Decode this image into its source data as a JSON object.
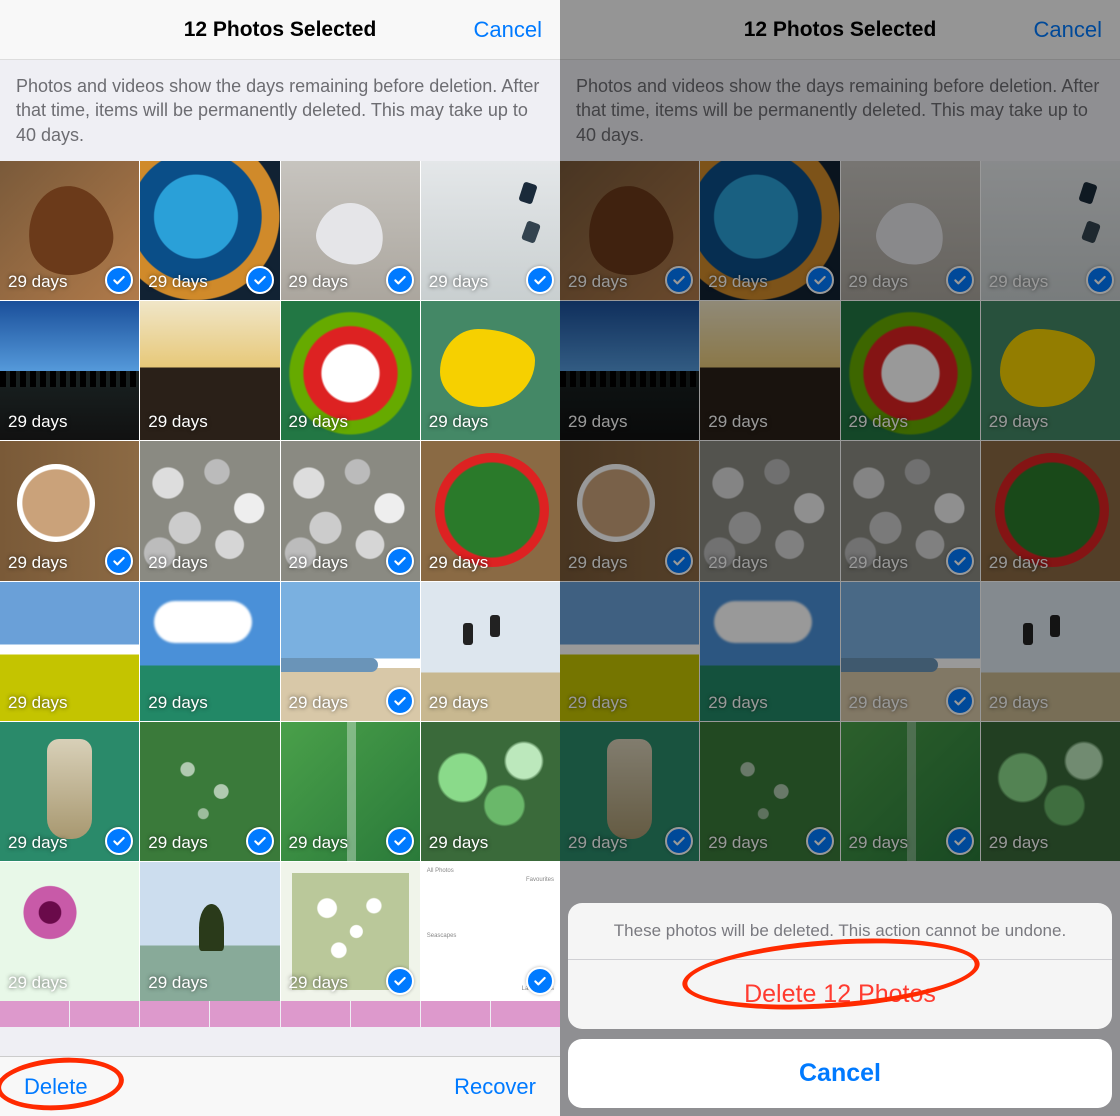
{
  "left": {
    "title": "12 Photos Selected",
    "cancel": "Cancel",
    "info": "Photos and videos show the days remaining before deletion. After that time, items will be permanently deleted. This may take up to 40 days.",
    "delete_label": "Delete",
    "recover_label": "Recover",
    "photos": [
      {
        "days": "29 days",
        "selected": true,
        "art": "t-leaf"
      },
      {
        "days": "29 days",
        "selected": true,
        "art": "t-gear"
      },
      {
        "days": "29 days",
        "selected": true,
        "art": "t-frost"
      },
      {
        "days": "29 days",
        "selected": true,
        "art": "t-jump"
      },
      {
        "days": "29 days",
        "selected": false,
        "art": "t-sky1"
      },
      {
        "days": "29 days",
        "selected": false,
        "art": "t-trees"
      },
      {
        "days": "29 days",
        "selected": false,
        "art": "t-tulip"
      },
      {
        "days": "29 days",
        "selected": false,
        "art": "t-poppy"
      },
      {
        "days": "29 days",
        "selected": true,
        "art": "t-coffee"
      },
      {
        "days": "29 days",
        "selected": false,
        "art": "t-pebbles"
      },
      {
        "days": "29 days",
        "selected": true,
        "art": "t-pebbles"
      },
      {
        "days": "29 days",
        "selected": false,
        "art": "t-salad"
      },
      {
        "days": "29 days",
        "selected": false,
        "art": "t-field"
      },
      {
        "days": "29 days",
        "selected": false,
        "art": "t-clouds"
      },
      {
        "days": "29 days",
        "selected": true,
        "art": "t-beach"
      },
      {
        "days": "29 days",
        "selected": false,
        "art": "t-jumpers"
      },
      {
        "days": "29 days",
        "selected": true,
        "art": "t-knocker"
      },
      {
        "days": "29 days",
        "selected": true,
        "art": "t-drops"
      },
      {
        "days": "29 days",
        "selected": true,
        "art": "t-leafmac"
      },
      {
        "days": "29 days",
        "selected": false,
        "art": "t-bokeh"
      },
      {
        "days": "29 days",
        "selected": false,
        "art": "t-flower"
      },
      {
        "days": "29 days",
        "selected": false,
        "art": "t-lonetree"
      },
      {
        "days": "29 days",
        "selected": true,
        "art": "t-blossom"
      },
      {
        "days": "",
        "selected": true,
        "art": "t-collage"
      }
    ],
    "collage": {
      "row1": "All Photos",
      "row2": "Favourites",
      "row3": "Seascapes",
      "row4": "Landscapes"
    }
  },
  "right": {
    "title": "12 Photos Selected",
    "cancel": "Cancel",
    "info": "Photos and videos show the days remaining before deletion. After that time, items will be permanently deleted. This may take up to 40 days.",
    "photos": [
      {
        "days": "29 days",
        "selected": true,
        "art": "t-leaf"
      },
      {
        "days": "29 days",
        "selected": true,
        "art": "t-gear"
      },
      {
        "days": "29 days",
        "selected": true,
        "art": "t-frost"
      },
      {
        "days": "29 days",
        "selected": true,
        "art": "t-jump"
      },
      {
        "days": "29 days",
        "selected": false,
        "art": "t-sky1"
      },
      {
        "days": "29 days",
        "selected": false,
        "art": "t-trees"
      },
      {
        "days": "29 days",
        "selected": false,
        "art": "t-tulip"
      },
      {
        "days": "29 days",
        "selected": false,
        "art": "t-poppy"
      },
      {
        "days": "29 days",
        "selected": true,
        "art": "t-coffee"
      },
      {
        "days": "29 days",
        "selected": false,
        "art": "t-pebbles"
      },
      {
        "days": "29 days",
        "selected": true,
        "art": "t-pebbles"
      },
      {
        "days": "29 days",
        "selected": false,
        "art": "t-salad"
      },
      {
        "days": "29 days",
        "selected": false,
        "art": "t-field"
      },
      {
        "days": "29 days",
        "selected": false,
        "art": "t-clouds"
      },
      {
        "days": "29 days",
        "selected": true,
        "art": "t-beach"
      },
      {
        "days": "29 days",
        "selected": false,
        "art": "t-jumpers"
      },
      {
        "days": "29 days",
        "selected": true,
        "art": "t-knocker"
      },
      {
        "days": "29 days",
        "selected": true,
        "art": "t-drops"
      },
      {
        "days": "29 days",
        "selected": true,
        "art": "t-leafmac"
      },
      {
        "days": "29 days",
        "selected": false,
        "art": "t-bokeh"
      }
    ],
    "sheet": {
      "message": "These photos will be deleted. This action cannot be undone.",
      "action": "Delete 12 Photos",
      "cancel": "Cancel"
    }
  }
}
